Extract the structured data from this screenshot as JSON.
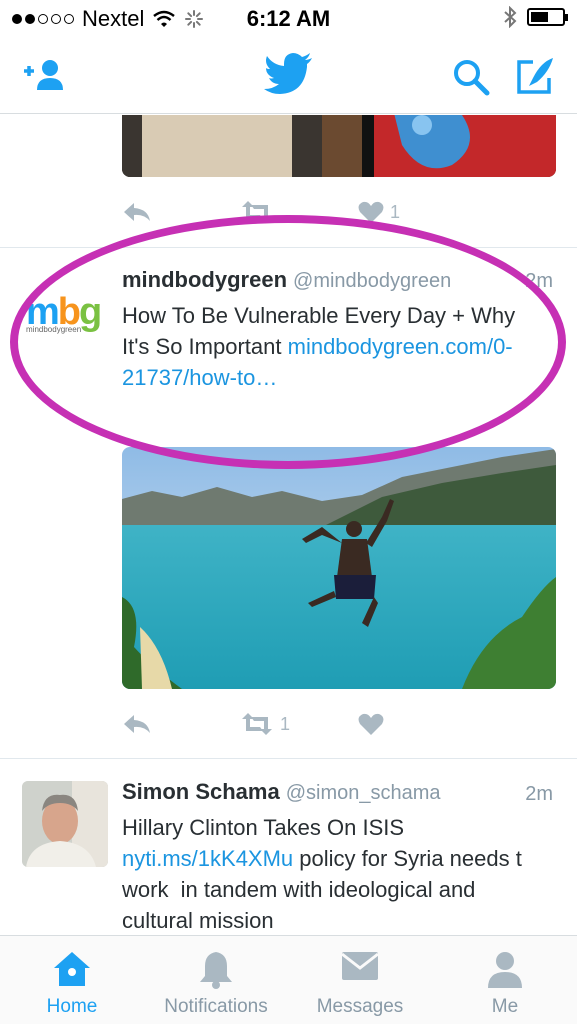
{
  "status_bar": {
    "carrier": "Nextel",
    "time": "6:12 AM",
    "battery_level": 0.55
  },
  "colors": {
    "accent": "#1da1f2",
    "link": "#1b95e0",
    "highlight": "#c630b4",
    "muted": "#8899a6"
  },
  "nav": {
    "icons": [
      "add-user-icon",
      "twitter-bird-icon",
      "search-icon",
      "compose-icon"
    ]
  },
  "tweets": [
    {
      "actions": {
        "retweets": "",
        "likes": "1"
      }
    },
    {
      "name": "mindbodygreen",
      "handle": "@mindbodygreen",
      "time": "2m",
      "avatar_text": "mbg",
      "avatar_subtext": "mindbodygreen",
      "text": "How To Be Vulnerable Every Day + Why It's So Important",
      "link": "mindbodygreen.com/0-21737/how-to…",
      "actions": {
        "retweets": "1",
        "likes": ""
      }
    },
    {
      "name": "Simon Schama",
      "handle": "@simon_schama",
      "time": "2m",
      "text_before": "Hillary Clinton Takes On ISIS ",
      "link": "nyti.ms/1kK4XMu",
      "text_after": " policy for Syria needs t work  in tandem with ideological and cultural mission"
    }
  ],
  "tabs": [
    {
      "label": "Home",
      "icon": "home-icon",
      "active": true
    },
    {
      "label": "Notifications",
      "icon": "bell-icon",
      "active": false
    },
    {
      "label": "Messages",
      "icon": "envelope-icon",
      "active": false
    },
    {
      "label": "Me",
      "icon": "person-icon",
      "active": false
    }
  ]
}
